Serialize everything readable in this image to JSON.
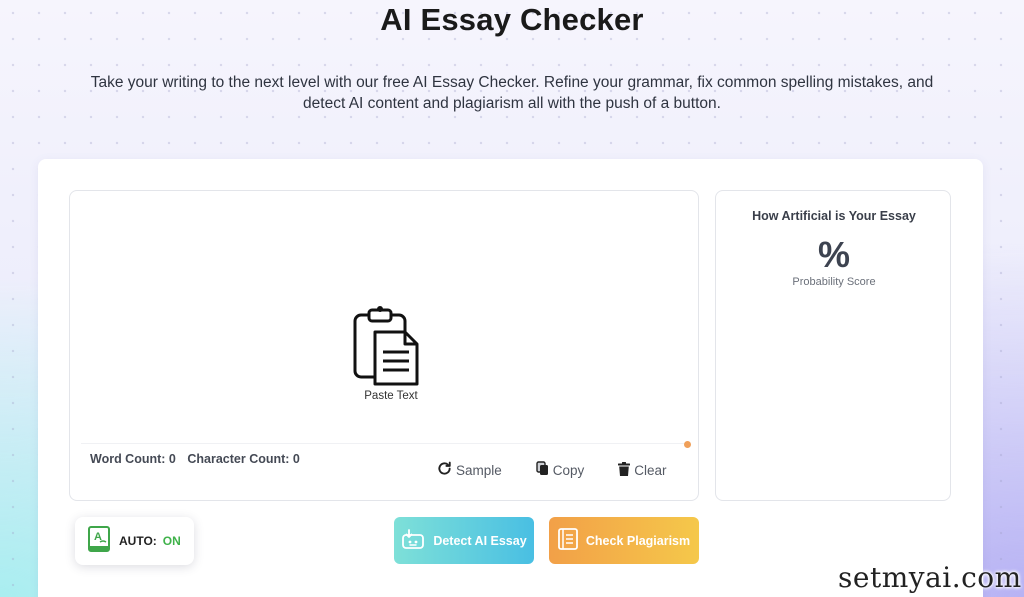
{
  "header": {
    "title": "AI Essay Checker",
    "subtitle": "Take your writing to the next level with our free AI Essay Checker. Refine your grammar, fix common spelling mistakes, and detect AI content and plagiarism all with the push of a button."
  },
  "editor": {
    "paste_label": "Paste Text",
    "word_count_label": "Word Count: 0",
    "char_count_label": "Character Count: 0",
    "actions": {
      "sample": "Sample",
      "copy": "Copy",
      "clear": "Clear"
    }
  },
  "result_panel": {
    "title": "How Artificial is Your Essay",
    "score_symbol": "%",
    "score_label": "Probability Score"
  },
  "auto_toggle": {
    "label": "AUTO:",
    "state": "ON"
  },
  "buttons": {
    "detect": "Detect AI Essay",
    "plagiarism": "Check Plagiarism"
  },
  "watermark": "setmyai.com",
  "colors": {
    "detect_gradient": [
      "#7ee0d8",
      "#49bfe3"
    ],
    "plagiarism_gradient": [
      "#f2a048",
      "#f5c84a"
    ],
    "auto_on": "#3fb24a",
    "status_dot": "#f0a05a"
  },
  "icons": {
    "paste": "clipboard-paste-icon",
    "sample": "refresh-icon",
    "copy": "copy-icon",
    "clear": "trash-icon",
    "auto": "grammar-book-icon",
    "detect": "robot-box-icon",
    "plagiarism": "document-list-icon"
  }
}
